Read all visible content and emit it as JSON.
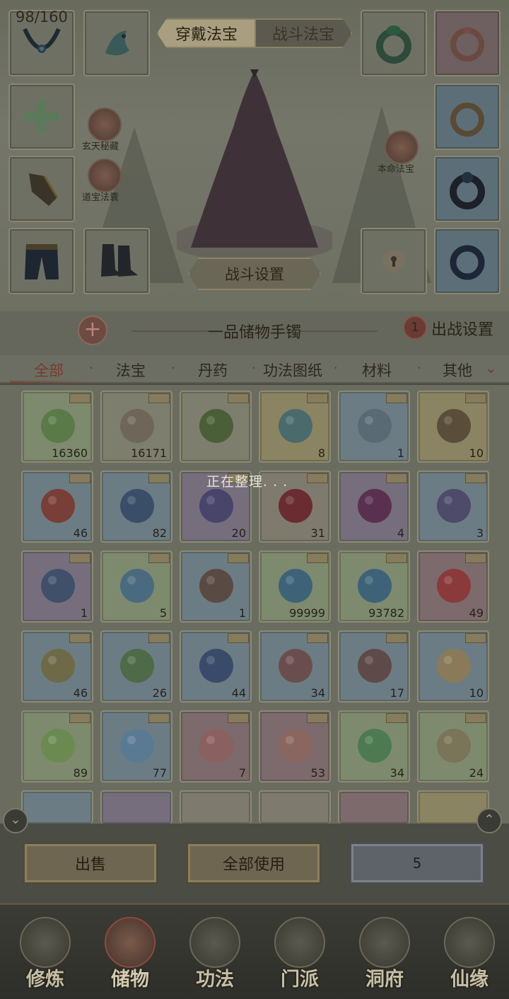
{
  "equip_tabs": {
    "worn": "穿戴法宝",
    "battle": "战斗法宝"
  },
  "left_buttons": {
    "secret": "玄天秘藏",
    "pouch": "道宝法囊"
  },
  "right_button": {
    "natal": "本命法宝"
  },
  "battle_settings": "战斗设置",
  "bag": {
    "capacity": "98/160",
    "title": "一品储物手镯",
    "sortie_count": "1",
    "sortie_label": "出战设置"
  },
  "categories": [
    "全部",
    "法宝",
    "丹药",
    "功法图纸",
    "材料",
    "其他"
  ],
  "active_category": "全部",
  "sorting_text": "正在整理. . .",
  "items_row1": [
    "16360",
    "16171",
    "",
    "8",
    "1",
    "10"
  ],
  "items_row2": [
    "46",
    "82",
    "20",
    "31",
    "4",
    "3"
  ],
  "items_row3": [
    "1",
    "5",
    "1",
    "99999",
    "93782",
    "49"
  ],
  "items_row4": [
    "46",
    "26",
    "44",
    "34",
    "17",
    "10"
  ],
  "items_row5": [
    "89",
    "77",
    "7",
    "53",
    "34",
    "24"
  ],
  "actions": {
    "sell": "出售",
    "use_all": "全部使用",
    "quantity": "5"
  },
  "nav": [
    "修炼",
    "储物",
    "功法",
    "门派",
    "洞府",
    "仙缘"
  ],
  "active_nav": "储物"
}
